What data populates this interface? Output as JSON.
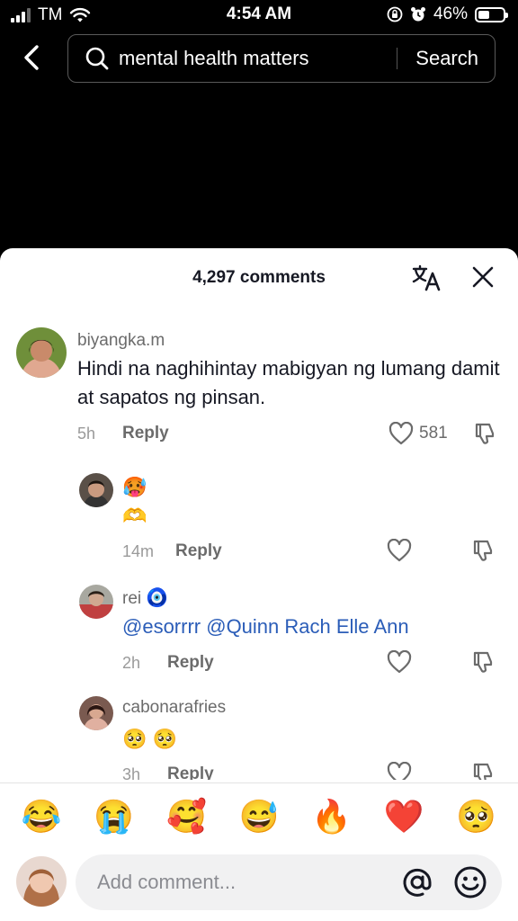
{
  "status_bar": {
    "carrier": "TM",
    "time": "4:54 AM",
    "battery": "46%",
    "battery_level": 0.46,
    "icons": [
      "signal-icon",
      "wifi-icon",
      "orientation-lock-icon",
      "alarm-icon",
      "battery-icon"
    ]
  },
  "search": {
    "query": "mental health matters",
    "button_label": "Search"
  },
  "comments_panel": {
    "count_label": "4,297 comments",
    "comments": [
      {
        "username": "biyangka.m",
        "text": "Hindi na naghihintay mabigyan ng lumang damit at sapatos ng pinsan.",
        "time": "5h",
        "reply_label": "Reply",
        "likes": "581"
      }
    ],
    "replies": [
      {
        "emoji_line1": "🥵",
        "emoji_line2": "🫶",
        "time": "14m",
        "reply_label": "Reply"
      },
      {
        "username": "rei",
        "username_emoji": "🧿",
        "mention1": "@esorrrr",
        "mention2": "@Quinn Rach Elle Ann",
        "time": "2h",
        "reply_label": "Reply"
      },
      {
        "username": "cabonarafries",
        "emoji_text": "🥺 🥺",
        "time": "3h",
        "reply_label": "Reply"
      }
    ]
  },
  "emoji_bar": [
    "😂",
    "😭",
    "🥰",
    "😅",
    "🔥",
    "❤️",
    "🥺"
  ],
  "input": {
    "placeholder": "Add comment..."
  },
  "colors": {
    "background": "#000000",
    "sheet": "#ffffff",
    "mention": "#2b5db8",
    "input_bg": "#f1f1f2"
  }
}
